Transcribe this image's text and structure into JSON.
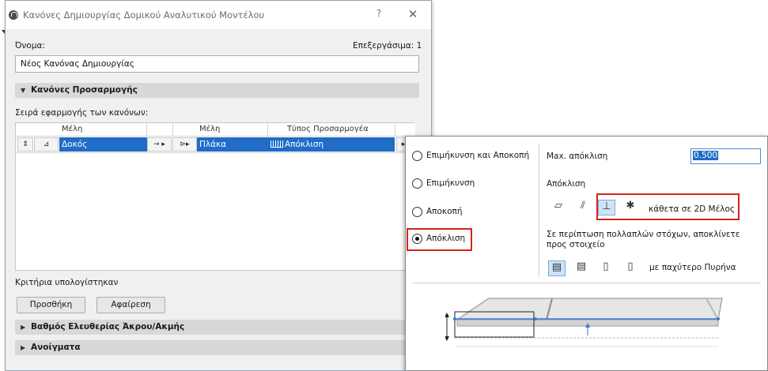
{
  "dialog": {
    "title": "Κανόνες Δημιουργίας Δομικού Αναλυτικού Μοντέλου",
    "help": "?",
    "close": "✕",
    "name_label": "Όνομα:",
    "editable_label": "Επεξεργάσιμα: 1",
    "name_value": "Νέος Κανόνας Δημιουργίας"
  },
  "sections": {
    "adjust_rules": "Κανόνες Προσαρμογής",
    "rule_order_label": "Σειρά εφαρμογής των κανόνων:",
    "criteria_label": "Κριτήρια υπολογίστηκαν",
    "add_button": "Προσθήκη",
    "remove_button": "Αφαίρεση",
    "end_freedom": "Βαθμός Ελευθερίας Άκρου/Ακμής",
    "openings": "Ανοίγματα"
  },
  "table": {
    "columns": [
      "Μέλη",
      "Μέλη",
      "Τύπος Προσαρμογέα"
    ],
    "rows": [
      {
        "member1": "Δοκός",
        "member2": "Πλάκα",
        "adjuster": "Απόκλιση"
      }
    ]
  },
  "panel": {
    "options": [
      {
        "label": "Επιμήκυνση και Αποκοπή",
        "selected": false
      },
      {
        "label": "Επιμήκυνση",
        "selected": false
      },
      {
        "label": "Αποκοπή",
        "selected": false
      },
      {
        "label": "Απόκλιση",
        "selected": true
      }
    ],
    "max_offset_label": "Max. απόκλιση",
    "max_offset_value": "0.500",
    "offset_label": "Απόκλιση",
    "perpendicular_label": "κάθετα σε 2D Μέλος",
    "multi_target_label": "Σε περίπτωση πολλαπλών στόχων, αποκλίνετε προς στοιχείο",
    "core_label": "με παχύτερο Πυρήνα"
  },
  "colors": {
    "selection": "#1f6dc7",
    "highlight": "#d8221e",
    "section_bg": "#d8d8d8"
  }
}
